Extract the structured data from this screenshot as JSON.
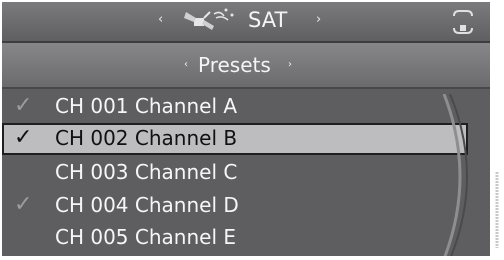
{
  "header": {
    "source_label": "SAT",
    "left_arrow": "‹",
    "right_arrow": "›"
  },
  "subheader": {
    "title": "Presets",
    "left_arrow": "‹",
    "right_arrow": "›"
  },
  "channels": [
    {
      "label": "CH 001 Channel A",
      "check": "✓",
      "checked": true,
      "selected": false
    },
    {
      "label": "CH 002 Channel B",
      "check": "✓",
      "checked": true,
      "selected": true
    },
    {
      "label": "CH 003 Channel C",
      "check": "",
      "checked": false,
      "selected": false
    },
    {
      "label": "CH 004 Channel D",
      "check": "✓",
      "checked": true,
      "selected": false
    },
    {
      "label": "CH 005 Channel E",
      "check": "",
      "checked": false,
      "selected": false
    }
  ],
  "colors": {
    "background": "#5a5a5c",
    "selected_row": "#bdbdbf",
    "text": "#f6f6f6"
  },
  "icons": {
    "source": "satellite-icon",
    "corner": "options-icon"
  }
}
